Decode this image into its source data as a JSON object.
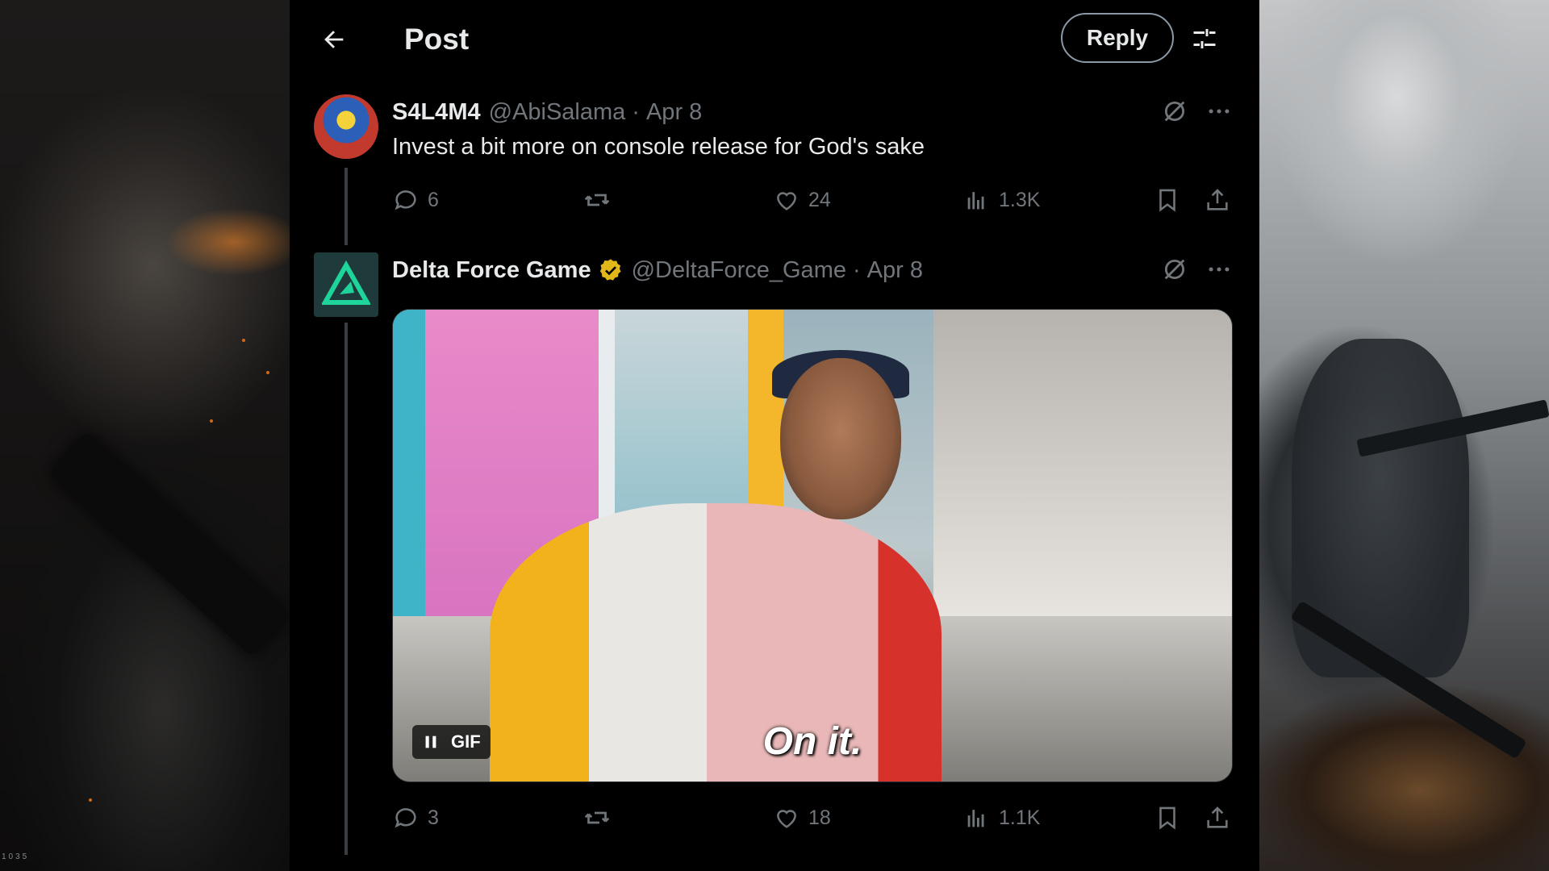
{
  "header": {
    "title": "Post",
    "reply_label": "Reply",
    "back_icon": "arrow-left-icon",
    "filter_icon": "sliders-icon"
  },
  "posts": [
    {
      "name": "S4L4M4",
      "handle": "@AbiSalama",
      "separator": "·",
      "date": "Apr 8",
      "text": "Invest a bit more on console release for God's sake",
      "replies": "6",
      "reposts": "",
      "likes": "24",
      "views": "1.3K"
    },
    {
      "name": "Delta Force Game",
      "verified": true,
      "handle": "@DeltaForce_Game",
      "separator": "·",
      "date": "Apr 8",
      "media": {
        "type": "GIF",
        "badge_label": "GIF",
        "caption": "On it."
      },
      "replies": "3",
      "reposts": "",
      "likes": "18",
      "views": "1.1K"
    }
  ],
  "side_left": {
    "corner_tag": "1035"
  },
  "colors": {
    "background": "#000000",
    "text": "#e7e9ea",
    "muted": "#71767b",
    "verified_gold": "#e2b719",
    "brand_green": "#1ed49b"
  }
}
